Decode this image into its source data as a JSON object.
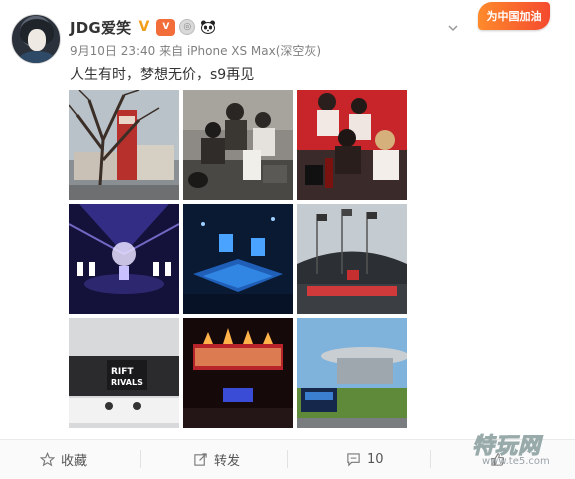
{
  "post": {
    "username": "JDG爱笑",
    "time": "9月10日 23:40",
    "source": "来自 iPhone XS Max(深空灰)",
    "text": "人生有时，梦想无价，s9再见",
    "badges": [
      "verified-v-icon",
      "member-icon",
      "medal-icon",
      "panda-icon"
    ]
  },
  "event_badge": {
    "label": "为中国加油"
  },
  "photos": [
    {
      "name": "photo-banner-tree"
    },
    {
      "name": "photo-players-desk"
    },
    {
      "name": "photo-players-red"
    },
    {
      "name": "photo-stage-purple"
    },
    {
      "name": "photo-arena-screens"
    },
    {
      "name": "photo-stadium-flags"
    },
    {
      "name": "photo-rift-rivals"
    },
    {
      "name": "photo-trophy-stage"
    },
    {
      "name": "photo-expo-center"
    }
  ],
  "actions": {
    "favorite": "收藏",
    "repost": "转发",
    "comment": "10",
    "like": ""
  },
  "watermark": {
    "main": "特玩网",
    "url": "www.te5.com"
  },
  "colors": {
    "accent_orange": "#f29c18",
    "text": "#333333",
    "meta": "#808080"
  }
}
